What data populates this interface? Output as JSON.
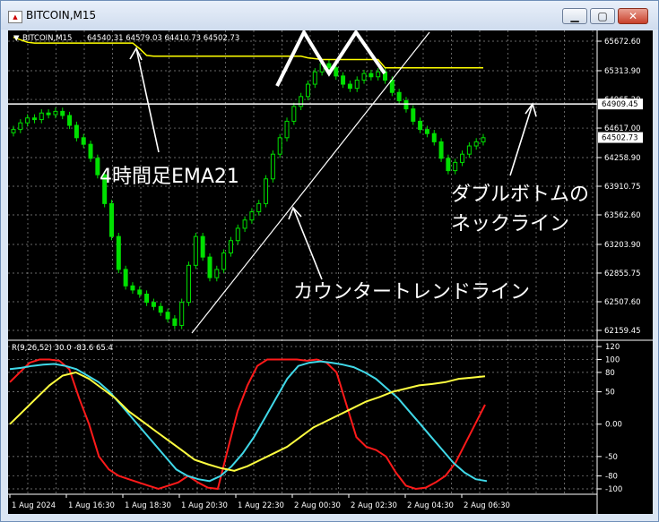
{
  "window": {
    "title": "BITCOIN,M15"
  },
  "header": {
    "symbol_label": "BITCOIN,M15",
    "ohlc": "64540.31 64579.03 64410.73 64502.73"
  },
  "indicator": {
    "label": "R(9,26,52) 30.0 -83.6 65.4"
  },
  "annotations": {
    "ema": "4時間足EMA21",
    "double_bottom_1": "ダブルボトムの",
    "double_bottom_2": "ネックライン",
    "counter_trend": "カウンタートレンドライン"
  },
  "colors": {
    "candle": "#00e000",
    "ema": "#ffff00",
    "red": "#ff1a1a",
    "cyan": "#40d8e8",
    "yellow": "#ffff40"
  },
  "chart_data": [
    {
      "type": "candlestick",
      "ylim": [
        62159.45,
        65672.6
      ],
      "yticks": [
        "65672.60",
        "65313.90",
        "64965.20",
        "64617.00",
        "64258.90",
        "63910.75",
        "63562.60",
        "63203.90",
        "62855.75",
        "62507.60",
        "62159.45"
      ],
      "price_tags": [
        "64909.45",
        "64502.73"
      ],
      "xticks": [
        "1 Aug 2024",
        "1 Aug 16:30",
        "1 Aug 18:30",
        "1 Aug 20:30",
        "1 Aug 22:30",
        "2 Aug 00:30",
        "2 Aug 02:30",
        "2 Aug 04:30",
        "2 Aug 06:30"
      ],
      "closes": [
        64600,
        64680,
        64740,
        64720,
        64800,
        64780,
        64820,
        64770,
        64650,
        64500,
        64420,
        64250,
        64050,
        63700,
        63300,
        62900,
        62700,
        62650,
        62600,
        62500,
        62450,
        62380,
        62300,
        62220,
        62500,
        62950,
        63300,
        63050,
        62800,
        62900,
        63100,
        63250,
        63400,
        63500,
        63600,
        63700,
        64000,
        64300,
        64500,
        64700,
        64880,
        65000,
        65150,
        65300,
        65400,
        65350,
        65250,
        65150,
        65100,
        65200,
        65280,
        65240,
        65300,
        65200,
        65050,
        64950,
        64850,
        64700,
        64600,
        64550,
        64450,
        64250,
        64100,
        64200,
        64300,
        64400,
        64450,
        64500
      ],
      "ema": [
        65720,
        65690,
        65660,
        65650,
        65650,
        65650,
        65650,
        65650,
        65650,
        65650,
        65650,
        65650,
        65650,
        65650,
        65650,
        65650,
        65650,
        65650,
        65580,
        65500,
        65490,
        65490,
        65490,
        65490,
        65490,
        65490,
        65490,
        65490,
        65490,
        65490,
        65490,
        65490,
        65490,
        65490,
        65490,
        65490,
        65490,
        65490,
        65490,
        65490,
        65490,
        65490,
        65470,
        65460,
        65450,
        65450,
        65450,
        65450,
        65450,
        65450,
        65450,
        65450,
        65450,
        65350,
        65350,
        65350,
        65350,
        65350,
        65350,
        65350,
        65350,
        65350,
        65350,
        65350,
        65350,
        65350,
        65350,
        65350
      ],
      "neckline": 64909.45
    },
    {
      "type": "line",
      "ylim": [
        -100,
        120
      ],
      "yticks": [
        "120",
        "100",
        "80",
        "50",
        "0.00",
        "-50",
        "-80",
        "-100"
      ],
      "series": [
        {
          "values": [
            65,
            80,
            95,
            100,
            100,
            98,
            85,
            40,
            0,
            -50,
            -70,
            -80,
            -85,
            -90,
            -95,
            -100,
            -95,
            -90,
            -80,
            -90,
            -98,
            -100,
            -40,
            20,
            60,
            90,
            100,
            100,
            100,
            100,
            98,
            100,
            95,
            80,
            30,
            -20,
            -35,
            -40,
            -50,
            -75,
            -95,
            -100,
            -98,
            -90,
            -80,
            -60,
            -30,
            0,
            30
          ]
        },
        {
          "values": [
            85,
            87,
            90,
            92,
            93,
            90,
            85,
            75,
            65,
            50,
            30,
            10,
            -10,
            -30,
            -50,
            -70,
            -80,
            -85,
            -88,
            -80,
            -65,
            -45,
            -20,
            10,
            40,
            70,
            90,
            95,
            97,
            95,
            92,
            88,
            80,
            70,
            55,
            40,
            20,
            0,
            -20,
            -40,
            -60,
            -75,
            -85,
            -88
          ]
        },
        {
          "values": [
            0,
            20,
            40,
            60,
            75,
            80,
            70,
            55,
            40,
            20,
            5,
            -10,
            -25,
            -40,
            -55,
            -62,
            -68,
            -72,
            -65,
            -55,
            -45,
            -35,
            -20,
            -5,
            5,
            15,
            25,
            35,
            42,
            50,
            55,
            60,
            62,
            65,
            70,
            72,
            74
          ]
        }
      ]
    }
  ]
}
